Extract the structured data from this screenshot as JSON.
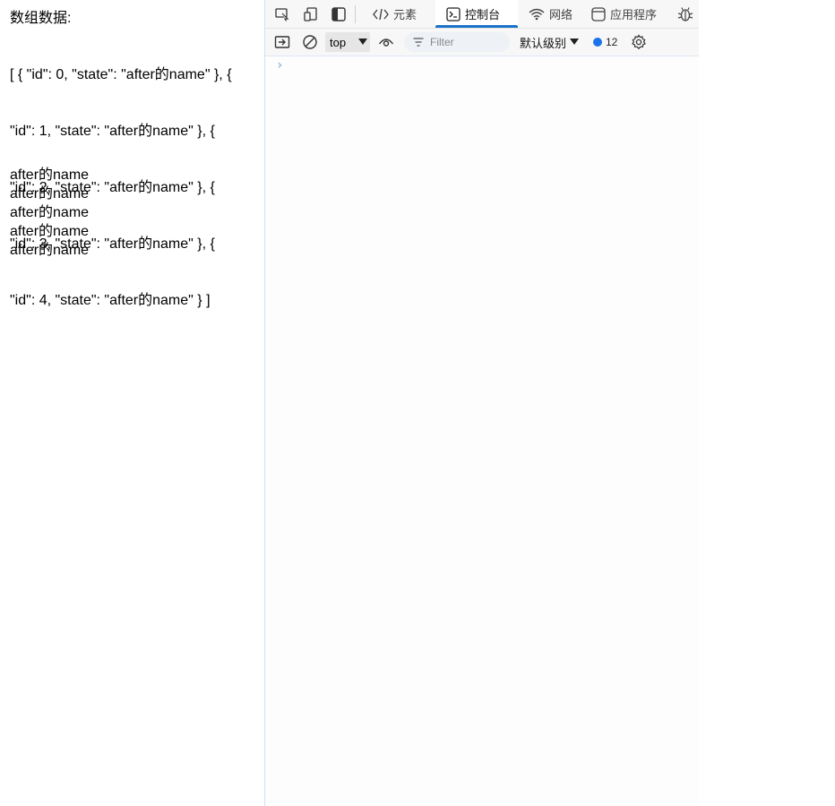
{
  "page": {
    "heading": "数组数据:",
    "json_lines": [
      "[ { \"id\": 0, \"state\": \"after的name\" }, {",
      "\"id\": 1, \"state\": \"after的name\" }, {",
      "\"id\": 2, \"state\": \"after的name\" }, {",
      "\"id\": 3, \"state\": \"after的name\" }, {",
      "\"id\": 4, \"state\": \"after的name\" } ]"
    ],
    "names": [
      "after的name",
      "after的name",
      "after的name",
      "after的name",
      "after的name"
    ]
  },
  "devtools": {
    "tabs": {
      "elements": "元素",
      "console": "控制台",
      "network": "网络",
      "application": "应用程序"
    },
    "active_tab": "console",
    "toolbar": {
      "context": "top",
      "filter_placeholder": "Filter",
      "levels": "默认级别",
      "issues_count": "12"
    },
    "prompt_symbol": "›",
    "colors": {
      "accent": "#1a73c8",
      "issue_badge": "#1a73e8"
    }
  }
}
